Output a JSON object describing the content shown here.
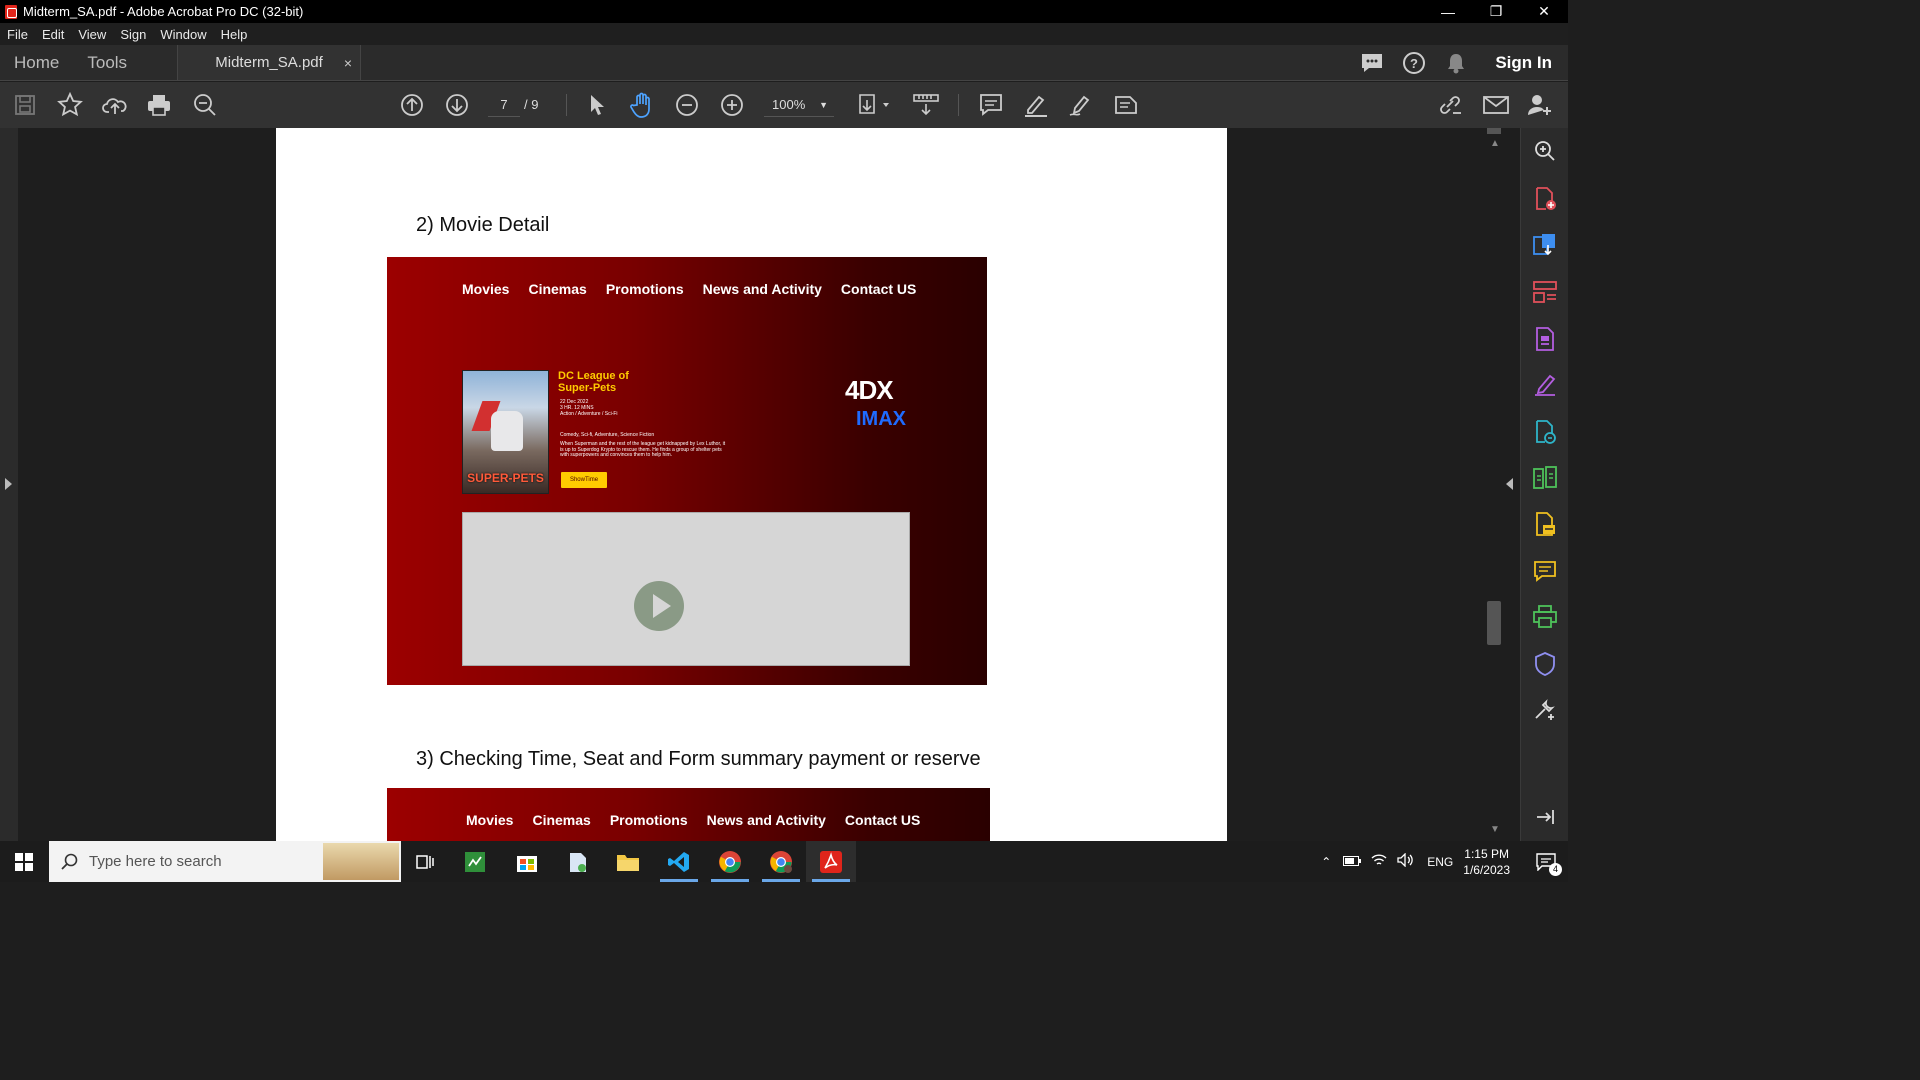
{
  "window": {
    "title": "Midterm_SA.pdf - Adobe Acrobat Pro DC (32-bit)",
    "controls": [
      "minimize",
      "restore",
      "close"
    ]
  },
  "menu": [
    "File",
    "Edit",
    "View",
    "Sign",
    "Window",
    "Help"
  ],
  "tabs": {
    "home": "Home",
    "tools": "Tools",
    "document": "Midterm_SA.pdf",
    "close_glyph": "×",
    "sign_in": "Sign In"
  },
  "toolbar": {
    "current_page": "7",
    "total_pages": "/ 9",
    "zoom": "100%"
  },
  "document": {
    "heading_2": "2)  Movie Detail",
    "heading_3": "3)  Checking Time, Seat and Form summary payment or reserve",
    "mockup_nav": [
      "Movies",
      "Cinemas",
      "Promotions",
      "News and Activity",
      "Contact US"
    ],
    "movie": {
      "title_line1": "DC League of",
      "title_line2": "Super-Pets",
      "date": "22 Dec 2022",
      "duration": "3 HR. 12 MINS",
      "genres_short": "Action / Adventure / Sci-Fi",
      "genres": "Comedy, Sci-fi, Adventure, Science Fiction",
      "description": "When Superman and the rest of the league get kidnapped by Lex Luthor, it is up to Superdog Krypto to rescue them. He finds a group of shelter pets with superpowers and convinces them to help him.",
      "poster_title": "SUPER-PETS",
      "showtime_button": "ShowTime",
      "format_4dx": "4DX",
      "format_imax": "IMAX"
    }
  },
  "taskbar": {
    "search_placeholder": "Type here to search",
    "language": "ENG",
    "time": "1:15 PM",
    "date": "1/6/2023",
    "notifications": "4"
  },
  "colors": {
    "accent_blue": "#1f6bff",
    "mock_red": "#9c0000",
    "yellow": "#ffcc00"
  }
}
